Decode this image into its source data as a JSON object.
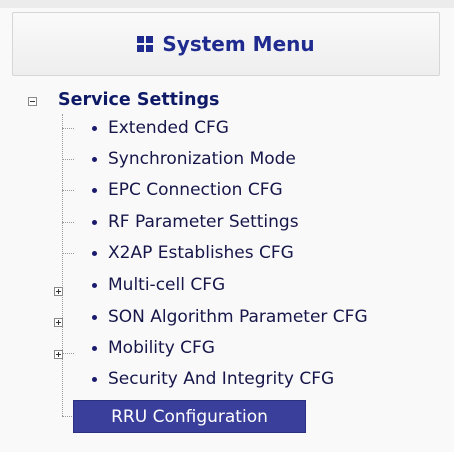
{
  "header": {
    "title": "System Menu",
    "icon": "grid-icon"
  },
  "section": {
    "label": "Service Settings",
    "expander": "collapse"
  },
  "items": [
    {
      "label": "Extended CFG",
      "expandable": false
    },
    {
      "label": "Synchronization Mode",
      "expandable": false
    },
    {
      "label": "EPC Connection CFG",
      "expandable": false
    },
    {
      "label": "RF Parameter Settings",
      "expandable": false
    },
    {
      "label": "X2AP Establishes CFG",
      "expandable": false
    },
    {
      "label": "Multi-cell CFG",
      "expandable": true
    },
    {
      "label": "SON Algorithm Parameter CFG",
      "expandable": true
    },
    {
      "label": "Mobility CFG",
      "expandable": true
    },
    {
      "label": "Security And Integrity CFG",
      "expandable": false
    }
  ],
  "selected_item": {
    "label": "RRU Configuration"
  },
  "colors": {
    "accent": "#1f2b8f",
    "selected_bg": "#3a3f9c",
    "text": "#16164a"
  }
}
